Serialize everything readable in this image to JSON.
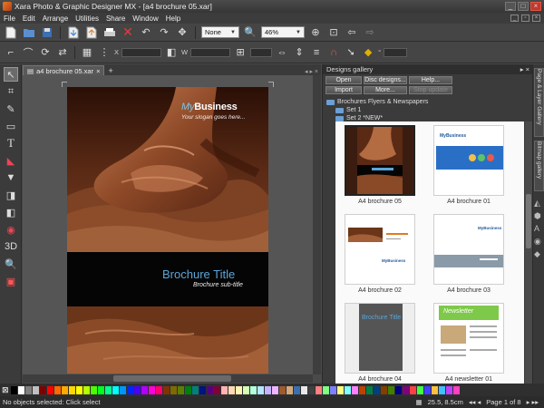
{
  "window": {
    "title": "Xara Photo & Graphic Designer MX - [a4 brochure 05.xar]",
    "controls": [
      "_",
      "□",
      "×"
    ]
  },
  "menu": {
    "items": [
      "File",
      "Edit",
      "Arrange",
      "Utilities",
      "Share",
      "Window",
      "Help"
    ]
  },
  "toolbar": {
    "quality_select": "None",
    "zoom_select": "46%",
    "fields": {
      "x_label": "X",
      "y_label": "Y",
      "w_label": "W",
      "h_label": "H",
      "angle_label": "°"
    }
  },
  "document": {
    "tab_label": "a4 brochure 05.xar",
    "add_tab": "+",
    "brand_prefix": "My",
    "brand_name": "Business",
    "slogan": "Your slogan goes here...",
    "brochure_title": "Brochure Title",
    "brochure_subtitle": "Brochure sub-title"
  },
  "gallery": {
    "title": "Designs gallery",
    "buttons": [
      {
        "label": "Open",
        "enabled": true
      },
      {
        "label": "Disc designs...",
        "enabled": true
      },
      {
        "label": "Help...",
        "enabled": true
      },
      {
        "label": "Import",
        "enabled": true
      },
      {
        "label": "More...",
        "enabled": true
      },
      {
        "label": "Stop update",
        "enabled": false
      }
    ],
    "tree": {
      "root": "Brochures Flyers & Newspapers",
      "sets": [
        "Set 1",
        "Set 2 *NEW*"
      ]
    },
    "items": [
      {
        "label": "A4 brochure 05",
        "selected": true
      },
      {
        "label": "A4 brochure 01",
        "selected": false
      },
      {
        "label": "A4 brochure 02",
        "selected": false
      },
      {
        "label": "A4 brochure 03",
        "selected": false
      },
      {
        "label": "A4 brochure 04",
        "selected": false
      },
      {
        "label": "A4 newsletter 01",
        "selected": false
      }
    ],
    "thumb_texts": {
      "mybusiness": "MyBusiness",
      "brochure_title": "Brochure Title",
      "newsletter": "Newsletter"
    }
  },
  "side_tabs": [
    "Page & Layer Gallery",
    "Bitmap gallery"
  ],
  "status": {
    "text": "No objects selected: Click select",
    "coords": "25.5, 8.5cm",
    "page": "Page 1 of 8"
  },
  "palette": [
    "#000000",
    "#ffffff",
    "#7f7f7f",
    "#c0c0c0",
    "#800000",
    "#ff0000",
    "#ff6a00",
    "#ffaa00",
    "#ffd800",
    "#ffff00",
    "#b6ff00",
    "#4cff00",
    "#00ff21",
    "#00ff90",
    "#00ffff",
    "#0094ff",
    "#0026ff",
    "#4800ff",
    "#b200ff",
    "#ff00dc",
    "#ff006e",
    "#7f3300",
    "#7f6a00",
    "#5b7f00",
    "#007f0e",
    "#007f7f",
    "#00137f",
    "#57007f",
    "#7f0037",
    "#ffb3b3",
    "#ffd9b3",
    "#fff3b3",
    "#d6ffb3",
    "#b3ffe0",
    "#b3e6ff",
    "#c2b3ff",
    "#f0b3ff",
    "#a05a2c",
    "#d4aa7a",
    "#3a6fb0",
    "#e8e8e8",
    "#404040",
    "#ff8080",
    "#80ff80",
    "#8080ff",
    "#ffff80",
    "#80ffff",
    "#ff80ff",
    "#c04000",
    "#008040",
    "#004080",
    "#804000",
    "#408000",
    "#000080",
    "#800080",
    "#ff4040",
    "#40ff40",
    "#4040ff",
    "#ffc040",
    "#40c0ff",
    "#c040ff",
    "#ff40c0"
  ]
}
